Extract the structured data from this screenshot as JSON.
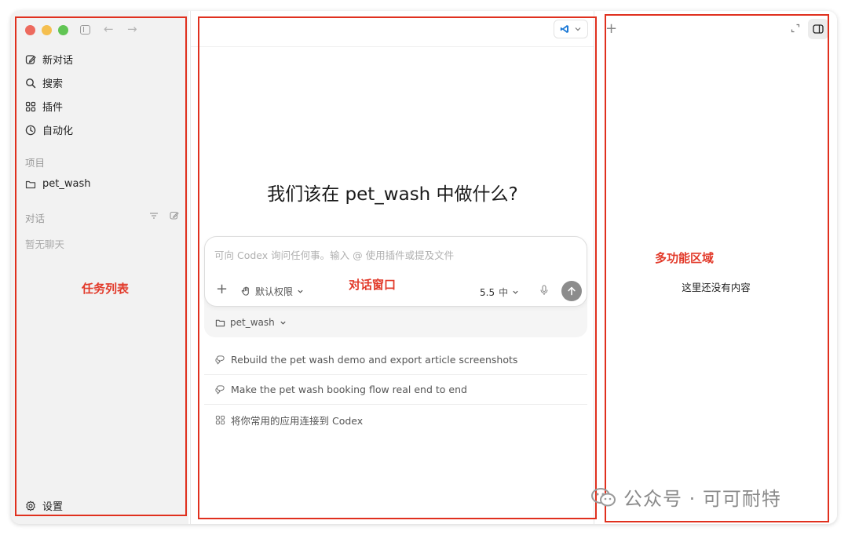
{
  "sidebar": {
    "items": [
      {
        "label": "新对话",
        "icon": "edit-icon"
      },
      {
        "label": "搜索",
        "icon": "search-icon"
      },
      {
        "label": "插件",
        "icon": "plugin-grid-icon"
      },
      {
        "label": "自动化",
        "icon": "clock-icon"
      }
    ],
    "projects_label": "项目",
    "project_name": "pet_wash",
    "conversations_label": "对话",
    "empty_chats": "暂无聊天",
    "settings_label": "设置"
  },
  "annotations": {
    "task_list": "任务列表",
    "chat_window": "对话窗口",
    "multi_area": "多功能区域"
  },
  "main": {
    "heading": "我们该在 pet_wash 中做什么?",
    "composer_placeholder": "可向 Codex 询问任何事。输入 @ 使用插件或提及文件",
    "permission_label": "默认权限",
    "model_version": "5.5",
    "model_effort": "中",
    "project_pill": "pet_wash",
    "suggestions": [
      {
        "text": "Rebuild the pet wash demo and export article screenshots",
        "icon": "chat-bubble-icon"
      },
      {
        "text": "Make the pet wash booking flow real end to end",
        "icon": "chat-bubble-icon"
      },
      {
        "text": "将你常用的应用连接到 Codex",
        "icon": "plugin-grid-icon"
      }
    ]
  },
  "right_panel": {
    "empty_text": "这里还没有内容"
  },
  "watermark": {
    "text": "公众号 · 可可耐特"
  },
  "colors": {
    "annotation_red": "#e0301e",
    "sidebar_bg": "#f2f2f2",
    "send_button": "#8c8c8c",
    "vscode_blue": "#1e7ad6"
  }
}
